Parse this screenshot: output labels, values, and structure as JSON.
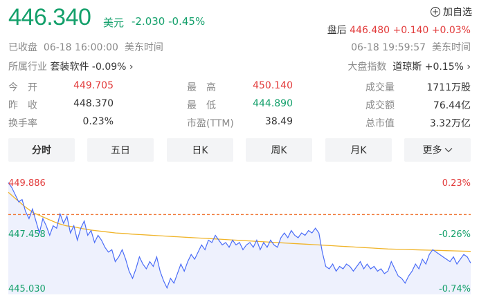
{
  "quote": {
    "price": "446.340",
    "currency": "美元",
    "change": "-2.030",
    "change_pct": "-0.45%"
  },
  "watchlist": {
    "icon": "plus-circle-icon",
    "label": "加自选"
  },
  "after_hours": {
    "label": "盘后",
    "price": "446.480",
    "change": "+0.140",
    "change_pct": "+0.03%"
  },
  "status": {
    "state": "已收盘",
    "close_time": "06-18 16:00:00",
    "tz": "美东时间",
    "after_time": "06-18 19:59:57",
    "after_tz": "美东时间"
  },
  "industry": {
    "label": "所属行业",
    "name": "套装软件",
    "change": "-0.09%",
    "chevron": "›"
  },
  "market_index": {
    "label": "大盘指数",
    "name": "道琼斯",
    "change": "+0.15%",
    "chevron": "›"
  },
  "stats": [
    {
      "key": "今　开",
      "value": "449.705",
      "color": "red"
    },
    {
      "key": "最　高",
      "value": "450.140",
      "color": "red"
    },
    {
      "key": "成交量",
      "value": "1711万股",
      "color": ""
    },
    {
      "key": "昨　收",
      "value": "448.370",
      "color": ""
    },
    {
      "key": "最　低",
      "value": "444.890",
      "color": "green"
    },
    {
      "key": "成交额",
      "value": "76.44亿",
      "color": ""
    },
    {
      "key": "换手率",
      "value": "0.23%",
      "color": ""
    },
    {
      "key": "市盈(TTM)",
      "value": "38.49",
      "color": ""
    },
    {
      "key": "总市值",
      "value": "3.32万亿",
      "color": ""
    }
  ],
  "tabs": [
    "分时",
    "五日",
    "日K",
    "周K",
    "月K",
    "更多"
  ],
  "tabs_more_icon": "chevron-down-icon",
  "colors": {
    "up": "#e23b3b",
    "down": "#14a06b",
    "price_line": "#4a6cf7",
    "avg_line": "#f0b429"
  },
  "chart_data": {
    "type": "line",
    "y_left_labels": [
      "449.886",
      "447.458",
      "445.030"
    ],
    "y_right_labels": [
      "0.23%",
      "-0.26%",
      "-0.74%"
    ],
    "prev_close": 448.37,
    "ylim": [
      445.03,
      449.886
    ],
    "series": [
      {
        "values": [
          449.7,
          449.5,
          449.2,
          448.9,
          449.0,
          448.5,
          448.2,
          448.6,
          448.1,
          447.6,
          448.2,
          447.9,
          447.5,
          447.9,
          447.8,
          448.4,
          448.0,
          448.3,
          447.6,
          447.9,
          447.3,
          447.8,
          448.1,
          447.5,
          447.7,
          447.2,
          447.5,
          447.3,
          447.0,
          446.8,
          446.9,
          446.4,
          446.6,
          446.9,
          446.5,
          446.0,
          445.7,
          446.1,
          446.6,
          446.3,
          446.1,
          446.4,
          446.2,
          446.6,
          446.0,
          445.6,
          445.3,
          445.7,
          445.5,
          445.9,
          446.3,
          446.0,
          446.4,
          446.7,
          446.5,
          446.8,
          447.1,
          446.9,
          447.3,
          447.2,
          447.5,
          447.3,
          447.1,
          447.2,
          447.0,
          447.3,
          447.1,
          447.2,
          446.9,
          447.1,
          447.2,
          447.0,
          447.3,
          446.9,
          447.2,
          447.0,
          447.3,
          447.1,
          447.0,
          447.4,
          447.6,
          447.4,
          447.7,
          447.5,
          447.4,
          447.6,
          447.5,
          447.7,
          447.6,
          447.8,
          447.6,
          446.8,
          446.2,
          446.1,
          446.3,
          446.0,
          446.2,
          446.1,
          446.3,
          446.2,
          446.0,
          446.2,
          446.4,
          446.1,
          446.3,
          446.1,
          446.2,
          446.0,
          446.1,
          445.9,
          446.0,
          446.4,
          446.1,
          445.8,
          445.7,
          445.5,
          445.8,
          446.0,
          446.3,
          446.1,
          446.5,
          446.3,
          446.7,
          446.9,
          446.8,
          446.7,
          446.6,
          446.5,
          446.4,
          446.6,
          446.3,
          446.5,
          446.7,
          446.6,
          446.34
        ]
      },
      {
        "name": "avg",
        "values": [
          449.3,
          449.0,
          448.7,
          448.45,
          448.3,
          448.15,
          448.0,
          447.9,
          447.85,
          447.78,
          447.72,
          447.68,
          447.64,
          447.6,
          447.58,
          447.55,
          447.53,
          447.51,
          447.49,
          447.47,
          447.45,
          447.43,
          447.41,
          447.39,
          447.37,
          447.35,
          447.33,
          447.31,
          447.29,
          447.27,
          447.25,
          447.23,
          447.21,
          447.19,
          447.17,
          447.15,
          447.13,
          447.11,
          447.09,
          447.07,
          447.05,
          447.03,
          447.01,
          446.99,
          446.97,
          446.95,
          446.93,
          446.92,
          446.91,
          446.9,
          446.89,
          446.88,
          446.87,
          446.86,
          446.85,
          446.84,
          446.83
        ]
      }
    ]
  }
}
